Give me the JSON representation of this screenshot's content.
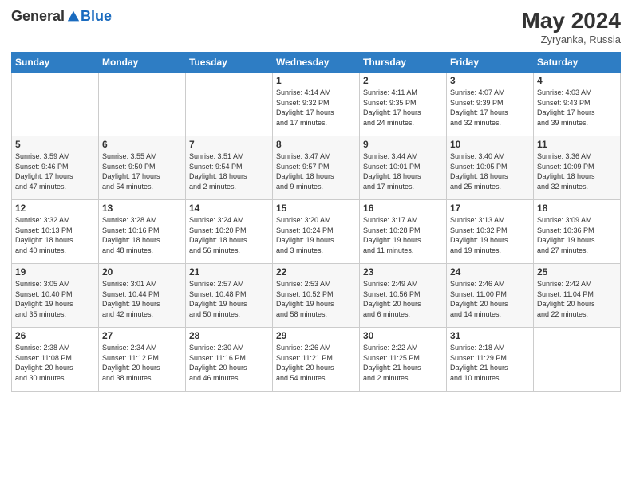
{
  "header": {
    "logo_general": "General",
    "logo_blue": "Blue",
    "month_year": "May 2024",
    "location": "Zyryanka, Russia"
  },
  "days_of_week": [
    "Sunday",
    "Monday",
    "Tuesday",
    "Wednesday",
    "Thursday",
    "Friday",
    "Saturday"
  ],
  "weeks": [
    [
      {
        "day": "",
        "info": ""
      },
      {
        "day": "",
        "info": ""
      },
      {
        "day": "",
        "info": ""
      },
      {
        "day": "1",
        "info": "Sunrise: 4:14 AM\nSunset: 9:32 PM\nDaylight: 17 hours\nand 17 minutes."
      },
      {
        "day": "2",
        "info": "Sunrise: 4:11 AM\nSunset: 9:35 PM\nDaylight: 17 hours\nand 24 minutes."
      },
      {
        "day": "3",
        "info": "Sunrise: 4:07 AM\nSunset: 9:39 PM\nDaylight: 17 hours\nand 32 minutes."
      },
      {
        "day": "4",
        "info": "Sunrise: 4:03 AM\nSunset: 9:43 PM\nDaylight: 17 hours\nand 39 minutes."
      }
    ],
    [
      {
        "day": "5",
        "info": "Sunrise: 3:59 AM\nSunset: 9:46 PM\nDaylight: 17 hours\nand 47 minutes."
      },
      {
        "day": "6",
        "info": "Sunrise: 3:55 AM\nSunset: 9:50 PM\nDaylight: 17 hours\nand 54 minutes."
      },
      {
        "day": "7",
        "info": "Sunrise: 3:51 AM\nSunset: 9:54 PM\nDaylight: 18 hours\nand 2 minutes."
      },
      {
        "day": "8",
        "info": "Sunrise: 3:47 AM\nSunset: 9:57 PM\nDaylight: 18 hours\nand 9 minutes."
      },
      {
        "day": "9",
        "info": "Sunrise: 3:44 AM\nSunset: 10:01 PM\nDaylight: 18 hours\nand 17 minutes."
      },
      {
        "day": "10",
        "info": "Sunrise: 3:40 AM\nSunset: 10:05 PM\nDaylight: 18 hours\nand 25 minutes."
      },
      {
        "day": "11",
        "info": "Sunrise: 3:36 AM\nSunset: 10:09 PM\nDaylight: 18 hours\nand 32 minutes."
      }
    ],
    [
      {
        "day": "12",
        "info": "Sunrise: 3:32 AM\nSunset: 10:13 PM\nDaylight: 18 hours\nand 40 minutes."
      },
      {
        "day": "13",
        "info": "Sunrise: 3:28 AM\nSunset: 10:16 PM\nDaylight: 18 hours\nand 48 minutes."
      },
      {
        "day": "14",
        "info": "Sunrise: 3:24 AM\nSunset: 10:20 PM\nDaylight: 18 hours\nand 56 minutes."
      },
      {
        "day": "15",
        "info": "Sunrise: 3:20 AM\nSunset: 10:24 PM\nDaylight: 19 hours\nand 3 minutes."
      },
      {
        "day": "16",
        "info": "Sunrise: 3:17 AM\nSunset: 10:28 PM\nDaylight: 19 hours\nand 11 minutes."
      },
      {
        "day": "17",
        "info": "Sunrise: 3:13 AM\nSunset: 10:32 PM\nDaylight: 19 hours\nand 19 minutes."
      },
      {
        "day": "18",
        "info": "Sunrise: 3:09 AM\nSunset: 10:36 PM\nDaylight: 19 hours\nand 27 minutes."
      }
    ],
    [
      {
        "day": "19",
        "info": "Sunrise: 3:05 AM\nSunset: 10:40 PM\nDaylight: 19 hours\nand 35 minutes."
      },
      {
        "day": "20",
        "info": "Sunrise: 3:01 AM\nSunset: 10:44 PM\nDaylight: 19 hours\nand 42 minutes."
      },
      {
        "day": "21",
        "info": "Sunrise: 2:57 AM\nSunset: 10:48 PM\nDaylight: 19 hours\nand 50 minutes."
      },
      {
        "day": "22",
        "info": "Sunrise: 2:53 AM\nSunset: 10:52 PM\nDaylight: 19 hours\nand 58 minutes."
      },
      {
        "day": "23",
        "info": "Sunrise: 2:49 AM\nSunset: 10:56 PM\nDaylight: 20 hours\nand 6 minutes."
      },
      {
        "day": "24",
        "info": "Sunrise: 2:46 AM\nSunset: 11:00 PM\nDaylight: 20 hours\nand 14 minutes."
      },
      {
        "day": "25",
        "info": "Sunrise: 2:42 AM\nSunset: 11:04 PM\nDaylight: 20 hours\nand 22 minutes."
      }
    ],
    [
      {
        "day": "26",
        "info": "Sunrise: 2:38 AM\nSunset: 11:08 PM\nDaylight: 20 hours\nand 30 minutes."
      },
      {
        "day": "27",
        "info": "Sunrise: 2:34 AM\nSunset: 11:12 PM\nDaylight: 20 hours\nand 38 minutes."
      },
      {
        "day": "28",
        "info": "Sunrise: 2:30 AM\nSunset: 11:16 PM\nDaylight: 20 hours\nand 46 minutes."
      },
      {
        "day": "29",
        "info": "Sunrise: 2:26 AM\nSunset: 11:21 PM\nDaylight: 20 hours\nand 54 minutes."
      },
      {
        "day": "30",
        "info": "Sunrise: 2:22 AM\nSunset: 11:25 PM\nDaylight: 21 hours\nand 2 minutes."
      },
      {
        "day": "31",
        "info": "Sunrise: 2:18 AM\nSunset: 11:29 PM\nDaylight: 21 hours\nand 10 minutes."
      },
      {
        "day": "",
        "info": ""
      }
    ]
  ]
}
